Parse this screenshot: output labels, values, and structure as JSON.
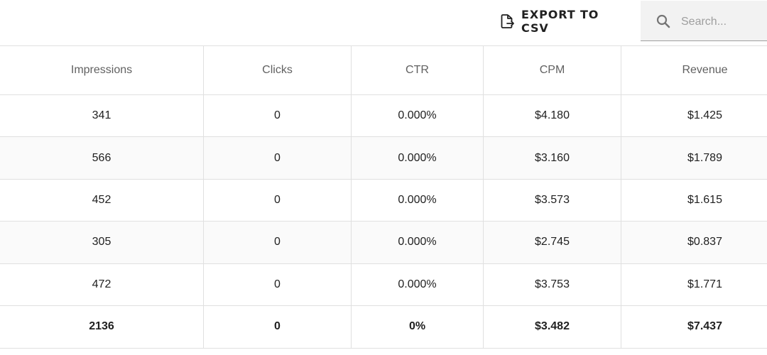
{
  "toolbar": {
    "export_label": "EXPORT TO CSV",
    "search_placeholder": "Search...",
    "search_value": ""
  },
  "table": {
    "columns": [
      "Impressions",
      "Clicks",
      "CTR",
      "CPM",
      "Revenue"
    ],
    "rows": [
      [
        "341",
        "0",
        "0.000%",
        "$4.180",
        "$1.425"
      ],
      [
        "566",
        "0",
        "0.000%",
        "$3.160",
        "$1.789"
      ],
      [
        "452",
        "0",
        "0.000%",
        "$3.573",
        "$1.615"
      ],
      [
        "305",
        "0",
        "0.000%",
        "$2.745",
        "$0.837"
      ],
      [
        "472",
        "0",
        "0.000%",
        "$3.753",
        "$1.771"
      ]
    ],
    "totals": [
      "2136",
      "0",
      "0%",
      "$3.482",
      "$7.437"
    ]
  },
  "colors": {
    "border": "#e0e0e0",
    "alt_row": "#fafafa",
    "search_bg": "#f2f2f2",
    "header_text": "#616161",
    "text": "#212121"
  },
  "icons": {
    "export": "file-export-icon",
    "search": "search-icon"
  }
}
